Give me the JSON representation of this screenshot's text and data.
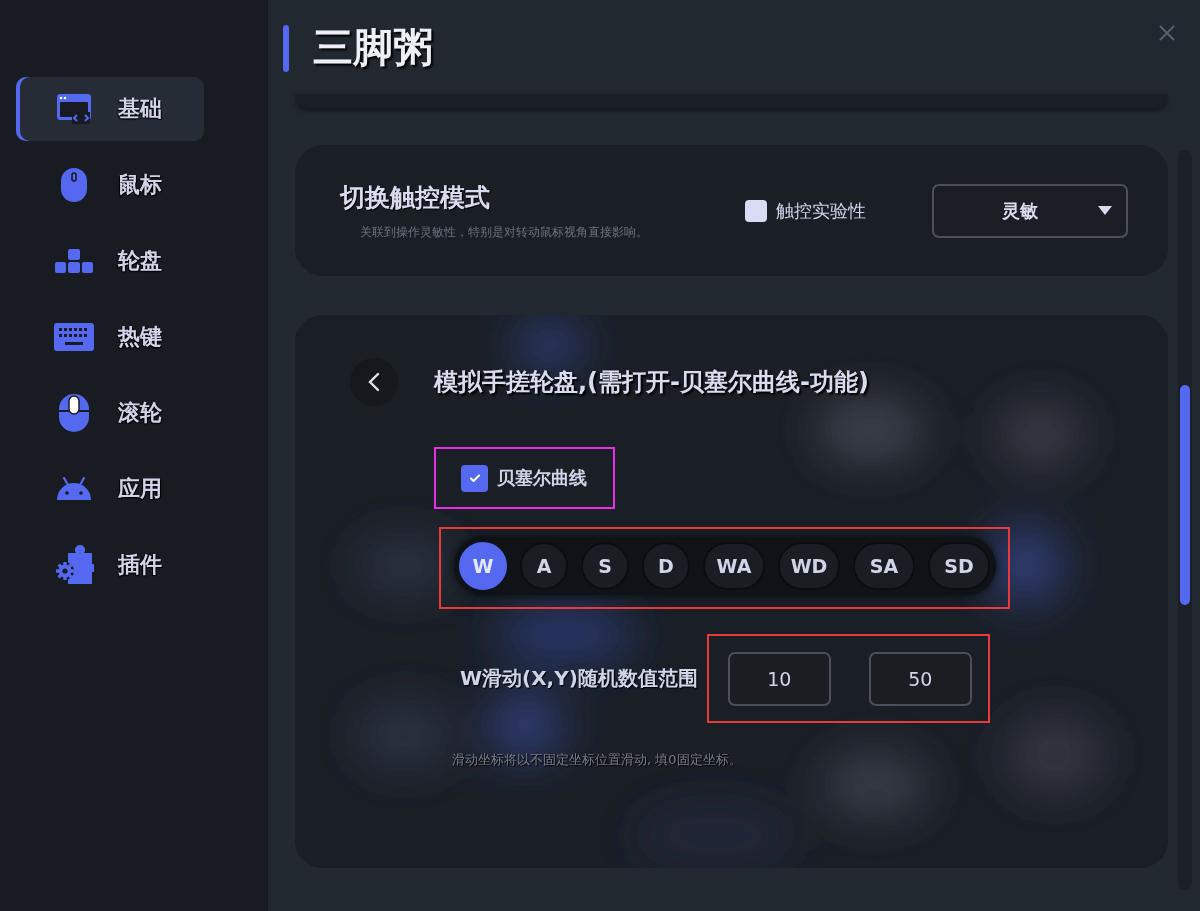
{
  "window": {
    "title": "三脚粥"
  },
  "sidebar": {
    "items": [
      {
        "label": "基础",
        "selected": true
      },
      {
        "label": "鼠标",
        "selected": false
      },
      {
        "label": "轮盘",
        "selected": false
      },
      {
        "label": "热键",
        "selected": false
      },
      {
        "label": "滚轮",
        "selected": false
      },
      {
        "label": "应用",
        "selected": false
      },
      {
        "label": "插件",
        "selected": false
      }
    ]
  },
  "mode_card": {
    "title": "切换触控模式",
    "description": "关联到操作灵敏性，特别是对转动鼠标视角直接影响。",
    "checkbox": {
      "label": "触控实验性",
      "checked": false
    },
    "dropdown": {
      "value": "灵敏"
    }
  },
  "wheel_card": {
    "title": "模拟手搓轮盘,(需打开-贝塞尔曲线-功能)",
    "bezier": {
      "label": "贝塞尔曲线",
      "checked": true,
      "color": "#e62ee6"
    },
    "keys": {
      "color": "#e83a3a",
      "items": [
        {
          "label": "W",
          "selected": true
        },
        {
          "label": "A",
          "selected": false
        },
        {
          "label": "S",
          "selected": false
        },
        {
          "label": "D",
          "selected": false
        },
        {
          "label": "WA",
          "selected": false
        },
        {
          "label": "WD",
          "selected": false
        },
        {
          "label": "SA",
          "selected": false
        },
        {
          "label": "SD",
          "selected": false
        }
      ]
    },
    "range": {
      "label": "W滑动(X,Y)随机数值范围",
      "color": "#e83a3a",
      "x": {
        "value": "10"
      },
      "y": {
        "value": "50"
      }
    },
    "note": "滑动坐标将以不固定坐标位置滑动, 填0固定坐标。"
  }
}
